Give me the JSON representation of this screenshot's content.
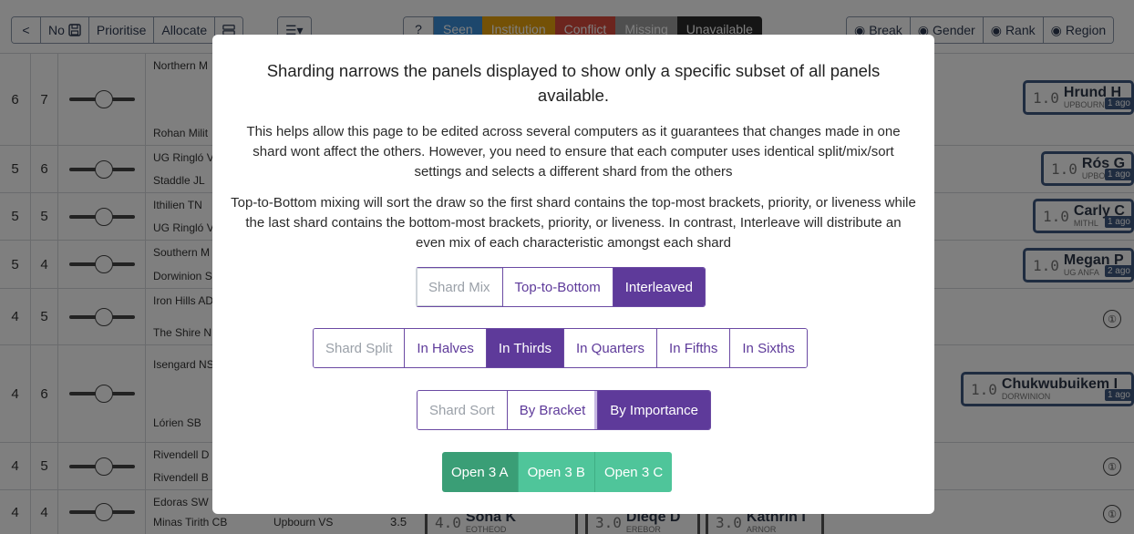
{
  "toolbar": {
    "back_label": "<",
    "no_label": "No",
    "prioritise_label": "Prioritise",
    "allocate_label": "Allocate",
    "menu_label": "☰▾",
    "help_label": "?",
    "states": [
      {
        "label": "Seen",
        "color": "#3a8ed8"
      },
      {
        "label": "Institution",
        "color": "#e9a20d"
      },
      {
        "label": "Conflict",
        "color": "#d94a3d"
      },
      {
        "label": "Missing",
        "color": "#9e9e9e"
      },
      {
        "label": "Unavailable",
        "color": "#2b2b2b"
      }
    ],
    "break_label": "Break",
    "gender_label": "Gender",
    "rank_label": "Rank",
    "region_label": "Region"
  },
  "rows": [
    {
      "rank": "6",
      "points": "7",
      "team_a": "Northern M",
      "team_b": "Rohan Milit"
    },
    {
      "rank": "5",
      "points": "6",
      "team_a": "UG Ringló V",
      "team_b": "Staddle JL"
    },
    {
      "rank": "5",
      "points": "5",
      "team_a": "Ithilien TN",
      "team_b": "UG Ringló V"
    },
    {
      "rank": "5",
      "points": "4",
      "team_a": "Southern M",
      "team_b": "Dorwinion S"
    },
    {
      "rank": "4",
      "points": "5",
      "team_a": "Iron Hills AD",
      "team_b": "The Shire N"
    },
    {
      "rank": "4",
      "points": "6",
      "team_a": "Isengard NS",
      "team_b": "Lórien SB"
    },
    {
      "rank": "4",
      "points": "5",
      "team_a": "Rivendell D",
      "team_b": "Rivendell B"
    },
    {
      "rank": "4",
      "points": "4",
      "team_a": "Edoras SW",
      "team_b": "Minas Tirith CB",
      "team_c": "Upbourn VS",
      "value": "3.5"
    }
  ],
  "judges": [
    {
      "score": "1.0",
      "name": "Hrund H",
      "inst": "UPBOURN",
      "tag": "1 ago"
    },
    {
      "score": "1.0",
      "name": "Rós G",
      "inst": "UPBO",
      "tag": "1 ago"
    },
    {
      "score": "1.0",
      "name": "Carly C",
      "inst": "MITHL",
      "tag": "1 ago"
    },
    {
      "score": "1.0",
      "name": "Megan P",
      "inst": "UG ANFA",
      "tag": "2 ago"
    },
    {
      "score": "1.0",
      "name": "Chukwubuikem I",
      "inst": "DORWINION",
      "tag": "1 ago"
    },
    {
      "score": "4.0",
      "name": "Sona K",
      "inst": "EOTHEOD"
    },
    {
      "score": "3.0",
      "name": "Dleqe D",
      "inst": "EREBOR"
    },
    {
      "score": "3.0",
      "name": "Kathrin I",
      "inst": "ARNOR"
    }
  ],
  "ellipsis_symbol": "①",
  "modal": {
    "title": "Sharding narrows the panels displayed to show only a specific subset of all panels available.",
    "p1": "This helps allow this page to be edited across several computers as it guarantees that changes made in one shard wont affect the others. However, you need to ensure that each computer uses identical split/mix/sort settings and selects a different shard from the others",
    "p2": "Top-to-Bottom mixing will sort the draw so the first shard contains the top-most brackets, priority, or liveness while the last shard contains the bottom-most brackets, priority, or liveness. In contrast, Interleave will distribute an even mix of each characteristic amongst each shard",
    "mix": {
      "label": "Shard Mix",
      "options": [
        "Top-to-Bottom",
        "Interleaved"
      ],
      "selected": "Interleaved"
    },
    "split": {
      "label": "Shard Split",
      "options": [
        "In Halves",
        "In Thirds",
        "In Quarters",
        "In Fifths",
        "In Sixths"
      ],
      "selected": "In Thirds"
    },
    "sort": {
      "label": "Shard Sort",
      "options": [
        "By Bracket",
        "By Importance"
      ],
      "selected": "By Importance"
    },
    "shards": [
      "Open 3 A",
      "Open 3 B",
      "Open 3 C"
    ],
    "selected_shard": "Open 3 A"
  },
  "colors": {
    "accent": "#5e3a9a",
    "shard_selected": "#3a9e76",
    "shard": "#4fc59a",
    "judge_border": "#3e5880"
  }
}
